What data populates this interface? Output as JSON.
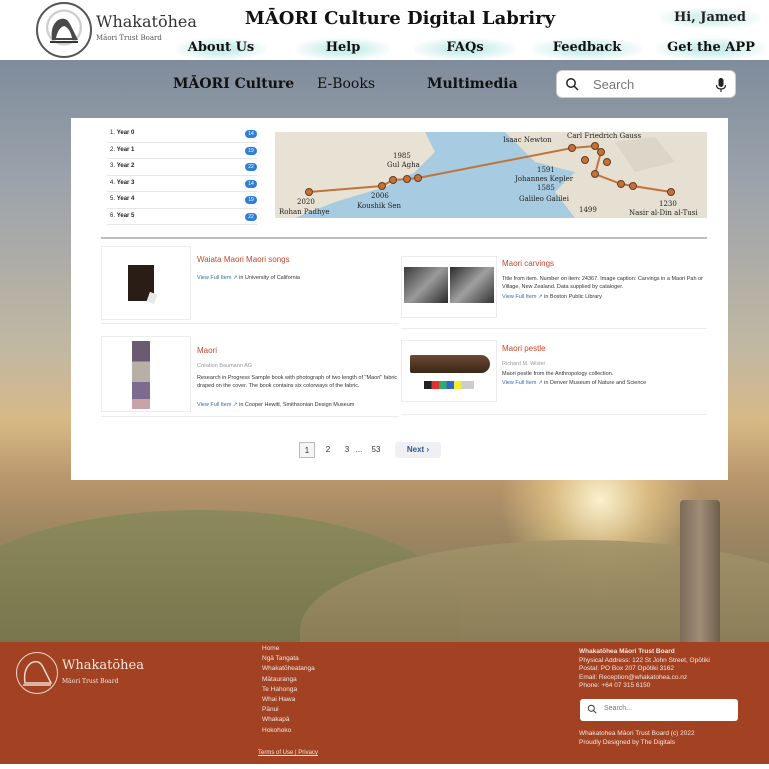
{
  "header": {
    "logo_name": "Whakatōhea",
    "logo_sub": "Māori Trust Board",
    "site_title": "MĀORI Culture Digital Labriry",
    "greeting": "Hi, Jamed",
    "nav": [
      "About Us",
      "Help",
      "FAQs",
      "Feedback",
      "Get the APP"
    ]
  },
  "subnav": {
    "items": [
      "MĀORI Culture",
      "E-Books",
      "Multimedia"
    ],
    "search_placeholder": "Search"
  },
  "years": [
    {
      "num": "1.",
      "label": "Year 0",
      "count": "14"
    },
    {
      "num": "2.",
      "label": "Year 1",
      "count": "19"
    },
    {
      "num": "3.",
      "label": "Year 2",
      "count": "22"
    },
    {
      "num": "4.",
      "label": "Year 3",
      "count": "14"
    },
    {
      "num": "5.",
      "label": "Year 4",
      "count": "19"
    },
    {
      "num": "6.",
      "label": "Year 5",
      "count": "22"
    }
  ],
  "map_labels": {
    "isaac": "Isaac Newton",
    "gauss": "Carl Friedrich Gauss",
    "y1985": "1985",
    "gul": "Gul Agha",
    "y1591": "1591",
    "kepler": "Johannes Kepler",
    "y1585": "1585",
    "galileo": "Galileo Galilei",
    "y2006": "2006",
    "koushik": "Koushik Sen",
    "y2020": "2020",
    "rohan": "Rohan Padhye",
    "y1499": "1499",
    "y1230": "1230",
    "nasir": "Nasir al-Din al-Tusi"
  },
  "cards": [
    {
      "title": "Waiata Maori Maori songs",
      "meta": "",
      "desc": "",
      "link": "View Full Item",
      "source": "in University of California"
    },
    {
      "title": "Maori carvings",
      "meta": "",
      "desc": "Title from item. Number on item: 24367. Image caption: Carvings in a Maori Pah or Village, New Zealand. Data supplied by cataloger.",
      "link": "View Full Item",
      "source": "in Boston Public Library"
    },
    {
      "title": "Maori",
      "meta": "Création Baumann AG",
      "desc": "Research in Progress Sample book with photograph of two length of \"Maori\" fabric draped on the cover. The book contains six colorways of the fabric.",
      "link": "View Full Item",
      "source": "in Cooper Hewitt, Smithsonian Design Museum"
    },
    {
      "title": "Maori pestle",
      "meta": "Richard M. Wixler",
      "desc": "Maori pestle from the Anthropology collection.",
      "link": "View Full Item",
      "source": "in Denver Museum of Nature and Science"
    }
  ],
  "pager": {
    "pages": [
      "1",
      "2",
      "3",
      "...",
      "53"
    ],
    "next": "Next ›"
  },
  "footer": {
    "logo_name": "Whakatōhea",
    "logo_sub": "Māori Trust Board",
    "links": [
      "Home",
      "Ngā Tangata",
      "Whakatōheatanga",
      "Mātauranga",
      "Te Hahonga",
      "Whai Hawa",
      "Pānui",
      "Whakapā",
      "Hokohoko"
    ],
    "legal_terms": "Terms of Use",
    "legal_sep": "|",
    "legal_privacy": "Privacy",
    "org": "Whakatōhea Māori Trust Board",
    "address": "Physical Address: 122 St John Street, Opōtiki",
    "postal": "Postal: PO Box 207 Opōtiki 3162",
    "email": "Email: Reception@whakatohea.co.nz",
    "phone": "Phone: +64 07 315 6150",
    "search_placeholder": "Search...",
    "copyright": "Whakatohea Māori Trust Board (c) 2022",
    "credit": "Proudly Designed by The Digitals"
  }
}
